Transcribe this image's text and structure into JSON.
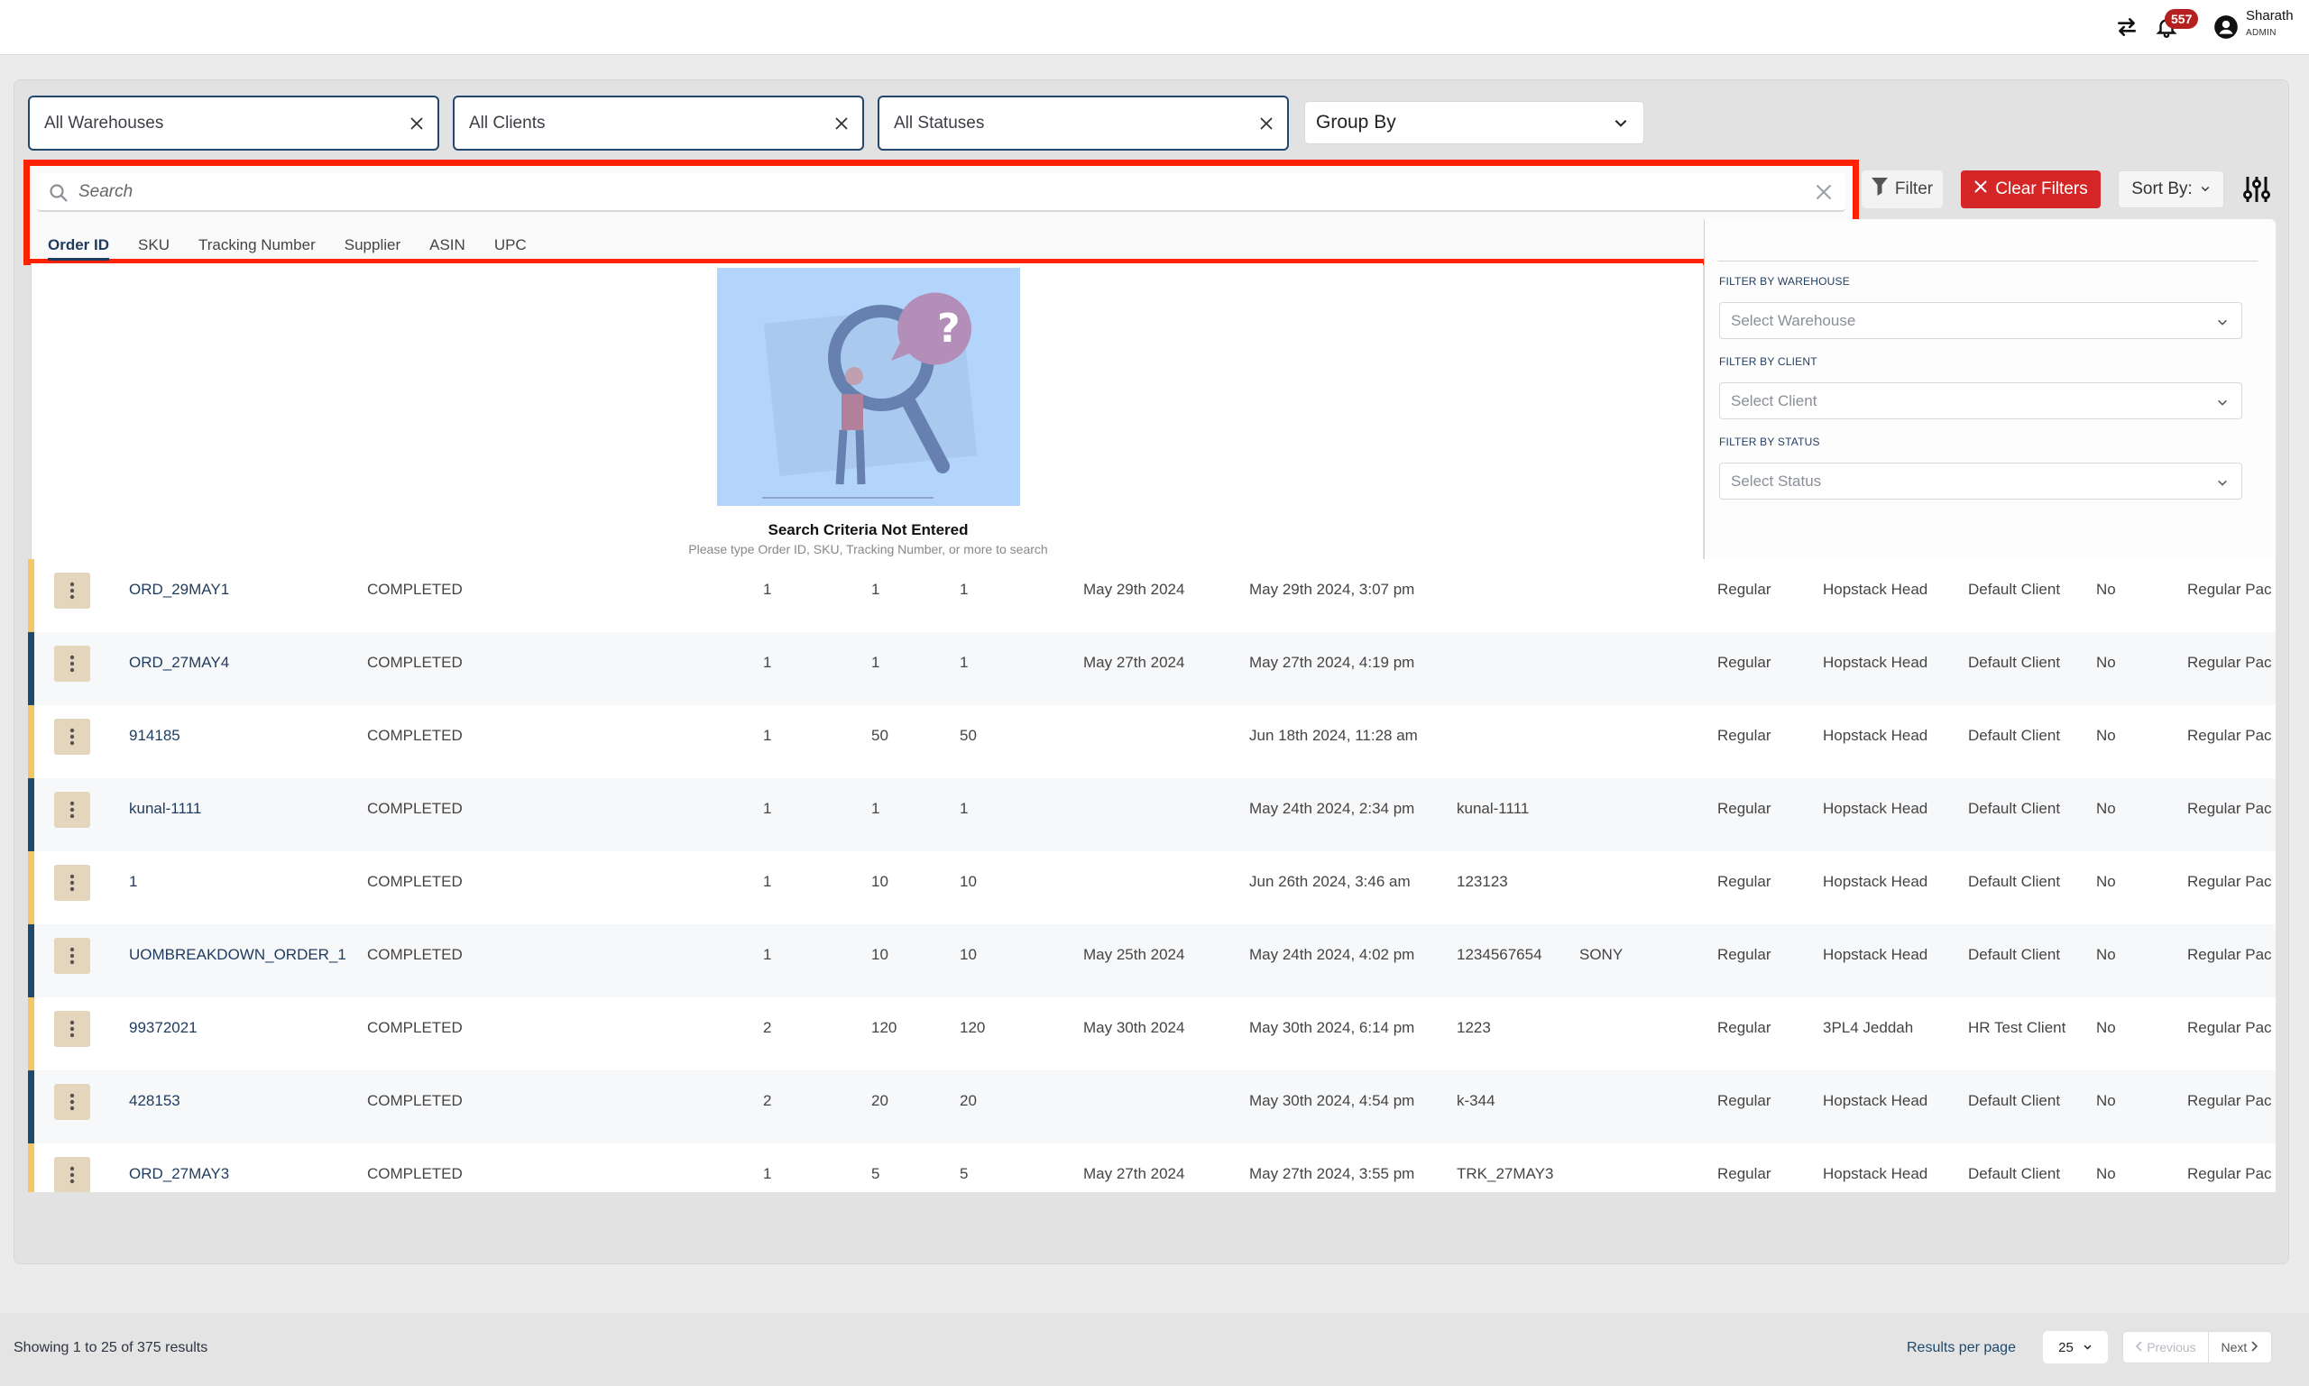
{
  "header": {
    "notifications_count": "557",
    "user_name": "Sharath",
    "user_role": "ADMIN"
  },
  "filters": {
    "warehouse_chip": "All Warehouses",
    "client_chip": "All Clients",
    "status_chip": "All Statuses",
    "group_by": "Group By"
  },
  "search": {
    "placeholder": "Search",
    "value": "",
    "tabs": [
      "Order ID",
      "SKU",
      "Tracking Number",
      "Supplier",
      "ASIN",
      "UPC"
    ],
    "active_tab": "Order ID"
  },
  "toolbar": {
    "filter_label": "Filter",
    "clear_filters_label": "Clear Filters",
    "sort_label": "Sort By:"
  },
  "empty_state": {
    "title": "Search Criteria Not Entered",
    "subtitle": "Please type Order ID, SKU, Tracking Number, or more to search"
  },
  "filter_panel": {
    "warehouse_label": "FILTER BY WAREHOUSE",
    "warehouse_placeholder": "Select Warehouse",
    "client_label": "FILTER BY CLIENT",
    "client_placeholder": "Select Client",
    "status_label": "FILTER BY STATUS",
    "status_placeholder": "Select Status"
  },
  "colors": {
    "accent_navy": "#1e3b5e",
    "clear_red": "#d42626",
    "row_yellow": "#f5c665",
    "row_navy": "#1e4a6e",
    "badge_red": "#b3201f"
  },
  "orders": [
    {
      "id": "ORD_29MAY1",
      "status": "COMPLETED",
      "a": "1",
      "b": "1",
      "c": "1",
      "date1": "May 29th 2024",
      "date2": "May 29th 2024, 3:07 pm",
      "tracking": "",
      "supplier": "",
      "type": "Regular",
      "warehouse": "Hopstack Head",
      "client": "Default Client",
      "flag": "No",
      "pack": "Regular Pac"
    },
    {
      "id": "ORD_27MAY4",
      "status": "COMPLETED",
      "a": "1",
      "b": "1",
      "c": "1",
      "date1": "May 27th 2024",
      "date2": "May 27th 2024, 4:19 pm",
      "tracking": "",
      "supplier": "",
      "type": "Regular",
      "warehouse": "Hopstack Head",
      "client": "Default Client",
      "flag": "No",
      "pack": "Regular Pac"
    },
    {
      "id": "914185",
      "status": "COMPLETED",
      "a": "1",
      "b": "50",
      "c": "50",
      "date1": "",
      "date2": "Jun 18th 2024, 11:28 am",
      "tracking": "",
      "supplier": "",
      "type": "Regular",
      "warehouse": "Hopstack Head",
      "client": "Default Client",
      "flag": "No",
      "pack": "Regular Pac"
    },
    {
      "id": "kunal-1111",
      "status": "COMPLETED",
      "a": "1",
      "b": "1",
      "c": "1",
      "date1": "",
      "date2": "May 24th 2024, 2:34 pm",
      "tracking": "kunal-1111",
      "supplier": "",
      "type": "Regular",
      "warehouse": "Hopstack Head",
      "client": "Default Client",
      "flag": "No",
      "pack": "Regular Pac"
    },
    {
      "id": "1",
      "status": "COMPLETED",
      "a": "1",
      "b": "10",
      "c": "10",
      "date1": "",
      "date2": "Jun 26th 2024, 3:46 am",
      "tracking": "123123",
      "supplier": "",
      "type": "Regular",
      "warehouse": "Hopstack Head",
      "client": "Default Client",
      "flag": "No",
      "pack": "Regular Pac"
    },
    {
      "id": "UOMBREAKDOWN_ORDER_1",
      "status": "COMPLETED",
      "a": "1",
      "b": "10",
      "c": "10",
      "date1": "May 25th 2024",
      "date2": "May 24th 2024, 4:02 pm",
      "tracking": "1234567654",
      "supplier": "SONY",
      "type": "Regular",
      "warehouse": "Hopstack Head",
      "client": "Default Client",
      "flag": "No",
      "pack": "Regular Pac"
    },
    {
      "id": "99372021",
      "status": "COMPLETED",
      "a": "2",
      "b": "120",
      "c": "120",
      "date1": "May 30th 2024",
      "date2": "May 30th 2024, 6:14 pm",
      "tracking": "1223",
      "supplier": "",
      "type": "Regular",
      "warehouse": "3PL4 Jeddah",
      "client": "HR Test Client",
      "flag": "No",
      "pack": "Regular Pac"
    },
    {
      "id": "428153",
      "status": "COMPLETED",
      "a": "2",
      "b": "20",
      "c": "20",
      "date1": "",
      "date2": "May 30th 2024, 4:54 pm",
      "tracking": "k-344",
      "supplier": "",
      "type": "Regular",
      "warehouse": "Hopstack Head",
      "client": "Default Client",
      "flag": "No",
      "pack": "Regular Pac"
    },
    {
      "id": "ORD_27MAY3",
      "status": "COMPLETED",
      "a": "1",
      "b": "5",
      "c": "5",
      "date1": "May 27th 2024",
      "date2": "May 27th 2024, 3:55 pm",
      "tracking": "TRK_27MAY3",
      "supplier": "",
      "type": "Regular",
      "warehouse": "Hopstack Head",
      "client": "Default Client",
      "flag": "No",
      "pack": "Regular Pac"
    }
  ],
  "footer": {
    "showing": "Showing 1 to 25 of 375 results",
    "results_per_page_label": "Results per page",
    "results_per_page": "25",
    "previous_label": "Previous",
    "next_label": "Next"
  }
}
